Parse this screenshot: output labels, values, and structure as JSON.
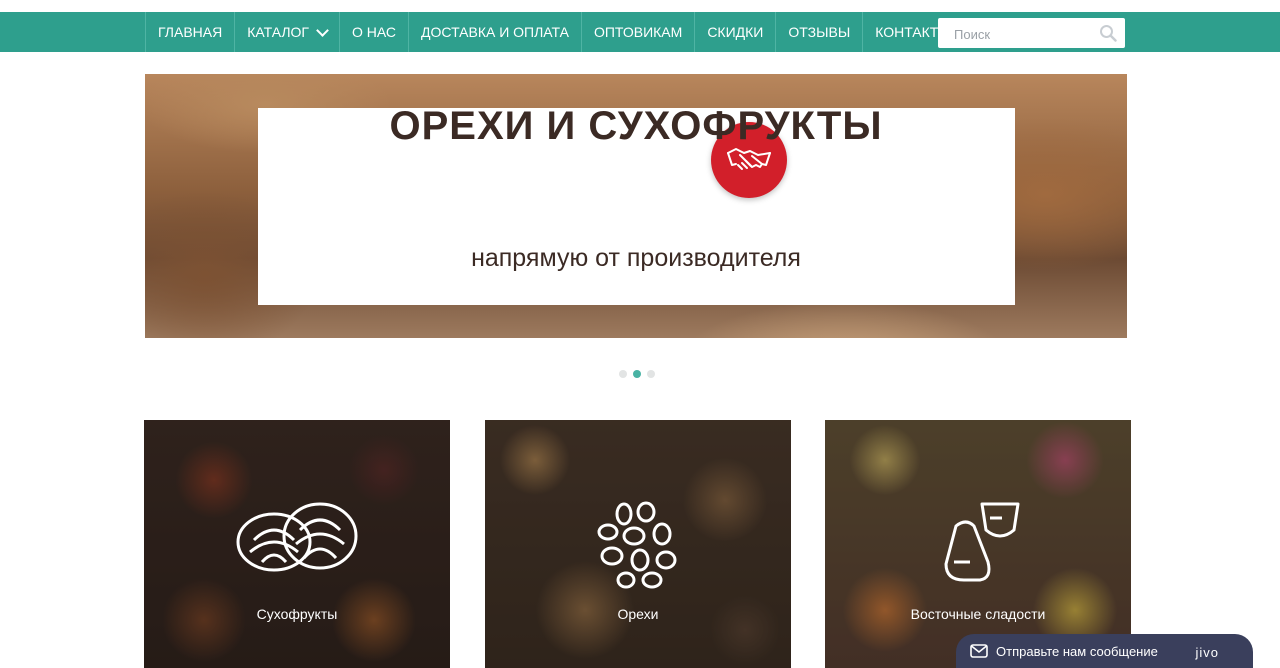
{
  "nav": {
    "items": [
      {
        "label": "ГЛАВНАЯ"
      },
      {
        "label": "КАТАЛОГ",
        "has_dropdown": true
      },
      {
        "label": "О НАС"
      },
      {
        "label": "ДОСТАВКА И ОПЛАТА"
      },
      {
        "label": "ОПТОВИКАМ"
      },
      {
        "label": "СКИДКИ"
      },
      {
        "label": "ОТЗЫВЫ"
      },
      {
        "label": "КОНТАКТЫ"
      }
    ],
    "search": {
      "placeholder": "Поиск",
      "value": "",
      "icon": "search-icon"
    }
  },
  "banner": {
    "title": "ОРЕХИ И СУХОФРУКТЫ",
    "subtitle": "напрямую от производителя",
    "badge_icon": "handshake-icon",
    "slides": 3,
    "active_slide": 2
  },
  "categories": [
    {
      "label": "Сухофрукты",
      "icon": "dried-fruit-icon"
    },
    {
      "label": "Орехи",
      "icon": "nuts-icon"
    },
    {
      "label": "Восточные сладости",
      "icon": "sweets-icon"
    }
  ],
  "chat": {
    "label": "Отправьте нам сообщение",
    "brand": "jivo",
    "icon": "envelope-icon"
  },
  "colors": {
    "nav": "#2e9f8d",
    "badge": "#d21f2a",
    "dot_active": "#49b3a4",
    "chat": "#3a3f5c"
  }
}
